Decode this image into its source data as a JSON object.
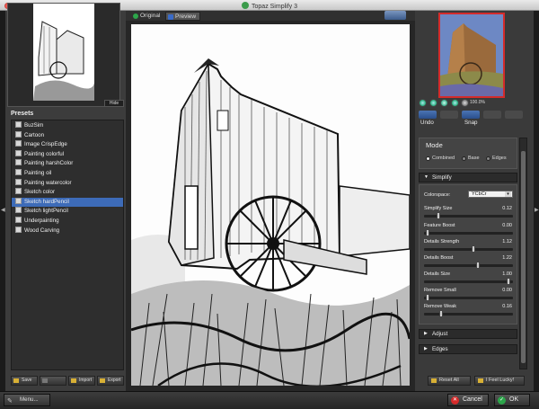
{
  "window": {
    "title": "Topaz Simplify 3"
  },
  "left_panel": {
    "hide_label": "Hide",
    "presets_title": "Presets",
    "presets": [
      "BuzSim",
      "Cartoon",
      "Image CrispEdge",
      "Painting colorful",
      "Painting harshColor",
      "Painting oil",
      "Painting watercolor",
      "Sketch color",
      "Sketch hardPencil",
      "Sketch lightPencil",
      "Underpainting",
      "Wood Carving"
    ],
    "selected_preset": "Sketch hardPencil",
    "buttons": {
      "save": "Save",
      "import": "Import",
      "export": "Export"
    }
  },
  "view_tabs": {
    "original": "Original",
    "preview": "Preview"
  },
  "right_panel": {
    "zoom_level": "100.0%",
    "toolbar": {
      "undo": "Undo",
      "snap": "Snap"
    },
    "mode": {
      "title": "Mode",
      "options": {
        "combined": "Combined",
        "base": "Base",
        "edges": "Edges"
      },
      "selected": "Combined"
    },
    "simplify": {
      "title": "Simplify",
      "colorspace_label": "Colorspace:",
      "colorspace_value": "YCbCr",
      "sliders": {
        "simplify_size": {
          "label": "Simplify Size",
          "value": "0.12",
          "fraction": 0.15
        },
        "feature_boost": {
          "label": "Feature Boost",
          "value": "0.00",
          "fraction": 0.02
        },
        "details_strength": {
          "label": "Details Strength",
          "value": "1.12",
          "fraction": 0.56
        },
        "details_boost": {
          "label": "Details Boost",
          "value": "1.22",
          "fraction": 0.61
        },
        "details_size": {
          "label": "Details Size",
          "value": "1.00",
          "fraction": 0.97
        },
        "remove_small": {
          "label": "Remove Small",
          "value": "0.00",
          "fraction": 0.02
        },
        "remove_weak": {
          "label": "Remove Weak",
          "value": "0.16",
          "fraction": 0.18
        }
      }
    },
    "adjust_title": "Adjust",
    "edges_title": "Edges",
    "reset_all": "Reset All",
    "lucky": "I Feel Lucky!"
  },
  "bottom": {
    "menu": "Menu...",
    "cancel": "Cancel",
    "ok": "OK"
  }
}
